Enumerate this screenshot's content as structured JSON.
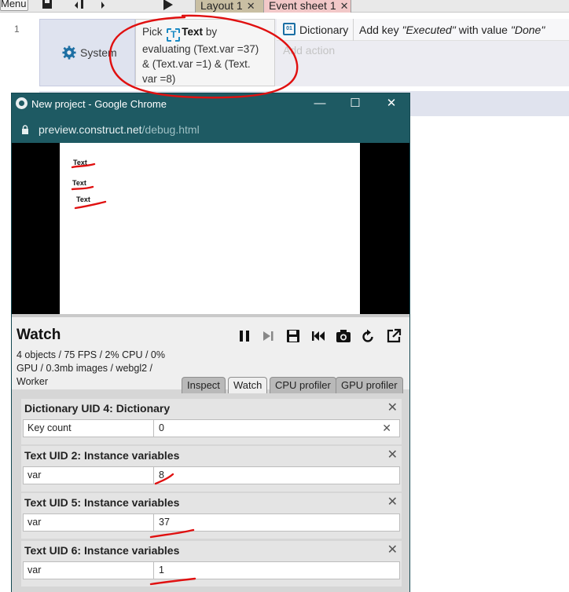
{
  "editor": {
    "menu_label": "Menu",
    "tabs": [
      {
        "label": "Layout 1",
        "close": "✕"
      },
      {
        "label": "Event sheet 1",
        "close": "✕"
      }
    ],
    "event": {
      "line_number": "1",
      "object": "System",
      "condition": {
        "prefix": "Pick",
        "object": "Text",
        "text": "by evaluating (Text.var =37) & (Text.var =1) & (Text. var =8)"
      },
      "action": {
        "object": "Dictionary",
        "text_prefix": "Add key ",
        "key": "Executed",
        "text_mid": " with value ",
        "value": "Done"
      },
      "add_action": "Add action"
    }
  },
  "browser": {
    "title": "New project - Google Chrome",
    "url_host": "preview.construct.net",
    "url_path": "/debug.html",
    "controls": {
      "minimize": "—",
      "maximize": "☐",
      "close": "✕"
    }
  },
  "game": {
    "texts": [
      "Text",
      "Text",
      "Text"
    ]
  },
  "debugger": {
    "title": "Watch",
    "stats": "4 objects / 75 FPS / 2% CPU / 0% GPU / 0.3mb images / webgl2 / Worker",
    "tabs": [
      "Inspect",
      "Watch",
      "CPU profiler",
      "GPU profiler"
    ],
    "active_tab": "Watch",
    "panels": [
      {
        "title": "Dictionary UID 4: Dictionary",
        "key": "Key count",
        "value": "0",
        "close": "✕",
        "row_close": "✕"
      },
      {
        "title": "Text UID 2: Instance variables",
        "key": "var",
        "value": "8",
        "close": "✕"
      },
      {
        "title": "Text UID 5: Instance variables",
        "key": "var",
        "value": "37",
        "close": "✕"
      },
      {
        "title": "Text UID 6: Instance variables",
        "key": "var",
        "value": "1",
        "close": "✕"
      }
    ]
  },
  "colors": {
    "annotation": "#e01010",
    "chrome_frame": "#1e5a63"
  }
}
